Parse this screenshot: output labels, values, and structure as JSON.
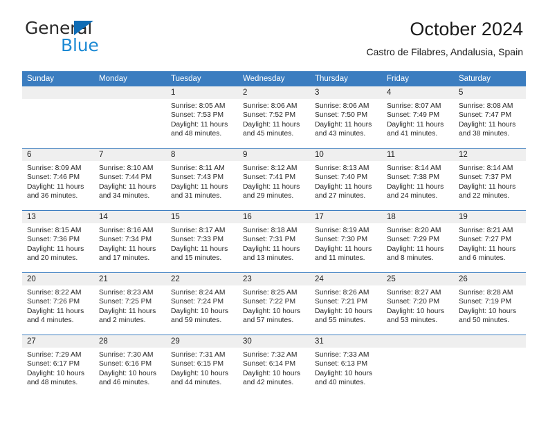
{
  "brand": {
    "name_part1": "General",
    "name_part2": "Blue",
    "triangle_color": "#0e6cb5",
    "blue_color": "#1d8ad4"
  },
  "header": {
    "title": "October 2024",
    "subtitle": "Castro de Filabres, Andalusia, Spain"
  },
  "theme": {
    "header_row_bg": "#3b7dc0",
    "daynum_band_bg": "#efefef",
    "row_divider": "#3b7dc0"
  },
  "weekday_headers": [
    "Sunday",
    "Monday",
    "Tuesday",
    "Wednesday",
    "Thursday",
    "Friday",
    "Saturday"
  ],
  "weeks": [
    [
      {
        "day": "",
        "empty": true
      },
      {
        "day": "",
        "empty": true
      },
      {
        "day": "1",
        "sunrise": "Sunrise: 8:05 AM",
        "sunset": "Sunset: 7:53 PM",
        "daylight": "Daylight: 11 hours and 48 minutes."
      },
      {
        "day": "2",
        "sunrise": "Sunrise: 8:06 AM",
        "sunset": "Sunset: 7:52 PM",
        "daylight": "Daylight: 11 hours and 45 minutes."
      },
      {
        "day": "3",
        "sunrise": "Sunrise: 8:06 AM",
        "sunset": "Sunset: 7:50 PM",
        "daylight": "Daylight: 11 hours and 43 minutes."
      },
      {
        "day": "4",
        "sunrise": "Sunrise: 8:07 AM",
        "sunset": "Sunset: 7:49 PM",
        "daylight": "Daylight: 11 hours and 41 minutes."
      },
      {
        "day": "5",
        "sunrise": "Sunrise: 8:08 AM",
        "sunset": "Sunset: 7:47 PM",
        "daylight": "Daylight: 11 hours and 38 minutes."
      }
    ],
    [
      {
        "day": "6",
        "sunrise": "Sunrise: 8:09 AM",
        "sunset": "Sunset: 7:46 PM",
        "daylight": "Daylight: 11 hours and 36 minutes."
      },
      {
        "day": "7",
        "sunrise": "Sunrise: 8:10 AM",
        "sunset": "Sunset: 7:44 PM",
        "daylight": "Daylight: 11 hours and 34 minutes."
      },
      {
        "day": "8",
        "sunrise": "Sunrise: 8:11 AM",
        "sunset": "Sunset: 7:43 PM",
        "daylight": "Daylight: 11 hours and 31 minutes."
      },
      {
        "day": "9",
        "sunrise": "Sunrise: 8:12 AM",
        "sunset": "Sunset: 7:41 PM",
        "daylight": "Daylight: 11 hours and 29 minutes."
      },
      {
        "day": "10",
        "sunrise": "Sunrise: 8:13 AM",
        "sunset": "Sunset: 7:40 PM",
        "daylight": "Daylight: 11 hours and 27 minutes."
      },
      {
        "day": "11",
        "sunrise": "Sunrise: 8:14 AM",
        "sunset": "Sunset: 7:38 PM",
        "daylight": "Daylight: 11 hours and 24 minutes."
      },
      {
        "day": "12",
        "sunrise": "Sunrise: 8:14 AM",
        "sunset": "Sunset: 7:37 PM",
        "daylight": "Daylight: 11 hours and 22 minutes."
      }
    ],
    [
      {
        "day": "13",
        "sunrise": "Sunrise: 8:15 AM",
        "sunset": "Sunset: 7:36 PM",
        "daylight": "Daylight: 11 hours and 20 minutes."
      },
      {
        "day": "14",
        "sunrise": "Sunrise: 8:16 AM",
        "sunset": "Sunset: 7:34 PM",
        "daylight": "Daylight: 11 hours and 17 minutes."
      },
      {
        "day": "15",
        "sunrise": "Sunrise: 8:17 AM",
        "sunset": "Sunset: 7:33 PM",
        "daylight": "Daylight: 11 hours and 15 minutes."
      },
      {
        "day": "16",
        "sunrise": "Sunrise: 8:18 AM",
        "sunset": "Sunset: 7:31 PM",
        "daylight": "Daylight: 11 hours and 13 minutes."
      },
      {
        "day": "17",
        "sunrise": "Sunrise: 8:19 AM",
        "sunset": "Sunset: 7:30 PM",
        "daylight": "Daylight: 11 hours and 11 minutes."
      },
      {
        "day": "18",
        "sunrise": "Sunrise: 8:20 AM",
        "sunset": "Sunset: 7:29 PM",
        "daylight": "Daylight: 11 hours and 8 minutes."
      },
      {
        "day": "19",
        "sunrise": "Sunrise: 8:21 AM",
        "sunset": "Sunset: 7:27 PM",
        "daylight": "Daylight: 11 hours and 6 minutes."
      }
    ],
    [
      {
        "day": "20",
        "sunrise": "Sunrise: 8:22 AM",
        "sunset": "Sunset: 7:26 PM",
        "daylight": "Daylight: 11 hours and 4 minutes."
      },
      {
        "day": "21",
        "sunrise": "Sunrise: 8:23 AM",
        "sunset": "Sunset: 7:25 PM",
        "daylight": "Daylight: 11 hours and 2 minutes."
      },
      {
        "day": "22",
        "sunrise": "Sunrise: 8:24 AM",
        "sunset": "Sunset: 7:24 PM",
        "daylight": "Daylight: 10 hours and 59 minutes."
      },
      {
        "day": "23",
        "sunrise": "Sunrise: 8:25 AM",
        "sunset": "Sunset: 7:22 PM",
        "daylight": "Daylight: 10 hours and 57 minutes."
      },
      {
        "day": "24",
        "sunrise": "Sunrise: 8:26 AM",
        "sunset": "Sunset: 7:21 PM",
        "daylight": "Daylight: 10 hours and 55 minutes."
      },
      {
        "day": "25",
        "sunrise": "Sunrise: 8:27 AM",
        "sunset": "Sunset: 7:20 PM",
        "daylight": "Daylight: 10 hours and 53 minutes."
      },
      {
        "day": "26",
        "sunrise": "Sunrise: 8:28 AM",
        "sunset": "Sunset: 7:19 PM",
        "daylight": "Daylight: 10 hours and 50 minutes."
      }
    ],
    [
      {
        "day": "27",
        "sunrise": "Sunrise: 7:29 AM",
        "sunset": "Sunset: 6:17 PM",
        "daylight": "Daylight: 10 hours and 48 minutes."
      },
      {
        "day": "28",
        "sunrise": "Sunrise: 7:30 AM",
        "sunset": "Sunset: 6:16 PM",
        "daylight": "Daylight: 10 hours and 46 minutes."
      },
      {
        "day": "29",
        "sunrise": "Sunrise: 7:31 AM",
        "sunset": "Sunset: 6:15 PM",
        "daylight": "Daylight: 10 hours and 44 minutes."
      },
      {
        "day": "30",
        "sunrise": "Sunrise: 7:32 AM",
        "sunset": "Sunset: 6:14 PM",
        "daylight": "Daylight: 10 hours and 42 minutes."
      },
      {
        "day": "31",
        "sunrise": "Sunrise: 7:33 AM",
        "sunset": "Sunset: 6:13 PM",
        "daylight": "Daylight: 10 hours and 40 minutes."
      },
      {
        "day": "",
        "empty": true
      },
      {
        "day": "",
        "empty": true
      }
    ]
  ]
}
